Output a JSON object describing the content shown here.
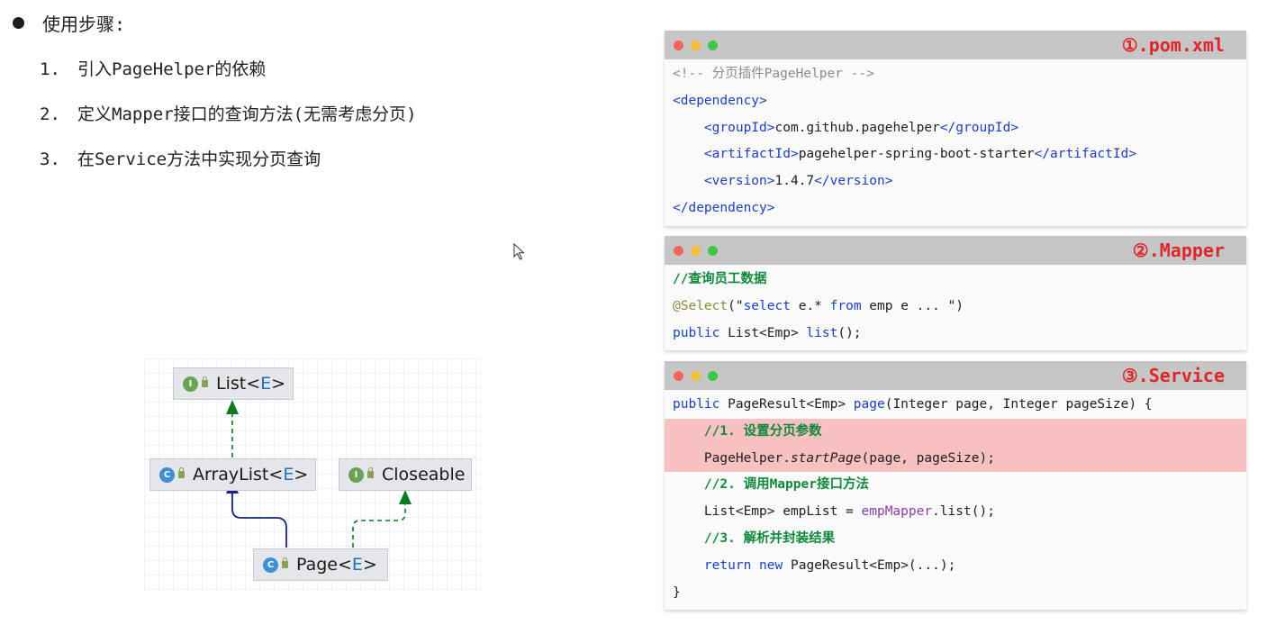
{
  "steps": {
    "title": "使用步骤:",
    "items": [
      {
        "num": "1.",
        "text": "引入PageHelper的依赖"
      },
      {
        "num": "2.",
        "text": "定义Mapper接口的查询方法(无需考虑分页)"
      },
      {
        "num": "3.",
        "text": "在Service方法中实现分页查询"
      }
    ]
  },
  "diagram": {
    "nodes": {
      "list": {
        "badge": "I",
        "name": "List<",
        "generic": "E",
        "close": ">"
      },
      "arraylist": {
        "badge": "C",
        "name": "ArrayList<",
        "generic": "E",
        "close": ">"
      },
      "closeable": {
        "badge": "I",
        "name": "Closeable"
      },
      "page": {
        "badge": "C",
        "name": "Page<",
        "generic": "E",
        "close": ">"
      }
    }
  },
  "panels": {
    "pom": {
      "title": "①.pom.xml",
      "lines": {
        "l1": "<!-- 分页插件PageHelper -->",
        "l2": "<dependency>",
        "l3a": "    <groupId>",
        "l3b": "com.github.pagehelper",
        "l3c": "</groupId>",
        "l4a": "    <artifactId>",
        "l4b": "pagehelper-spring-boot-starter",
        "l4c": "</artifactId>",
        "l5a": "    <version>",
        "l5b": "1.4.7",
        "l5c": "</version>",
        "l6": "</dependency>"
      }
    },
    "mapper": {
      "title": "②.Mapper",
      "lines": {
        "l1": "//查询员工数据",
        "l2a": "@Select",
        "l2b": "(\"",
        "l2c": "select",
        "l2d": " e.* ",
        "l2e": "from",
        "l2f": " emp e ... \")",
        "l3a": "public",
        "l3b": " List<Emp> ",
        "l3c": "list",
        "l3d": "();"
      }
    },
    "service": {
      "title": "③.Service",
      "lines": {
        "l1a": "public",
        "l1b": " PageResult<Emp> ",
        "l1c": "page",
        "l1d": "(Integer page, Integer pageSize) {",
        "l2": "    //1. 设置分页参数",
        "l3a": "    PageHelper.",
        "l3b": "startPage",
        "l3c": "(page, pageSize);",
        "l4": "    //2. 调用Mapper接口方法",
        "l5a": "    List<Emp> empList = ",
        "l5b": "empMapper",
        "l5c": ".list();",
        "l6": "    //3. 解析并封装结果",
        "l7a": "    ",
        "l7b": "return",
        "l7c": " ",
        "l7d": "new",
        "l7e": " PageResult<Emp>(...);",
        "l8": "}"
      }
    }
  },
  "colors": {
    "dot_red": "#f2655b",
    "dot_yellow": "#f5bd3b",
    "dot_green": "#3cc648",
    "title_red": "#e0262a",
    "highlight": "#f7c1c1",
    "interface_badge": "#6aa356",
    "class_badge": "#3d8fd6"
  }
}
